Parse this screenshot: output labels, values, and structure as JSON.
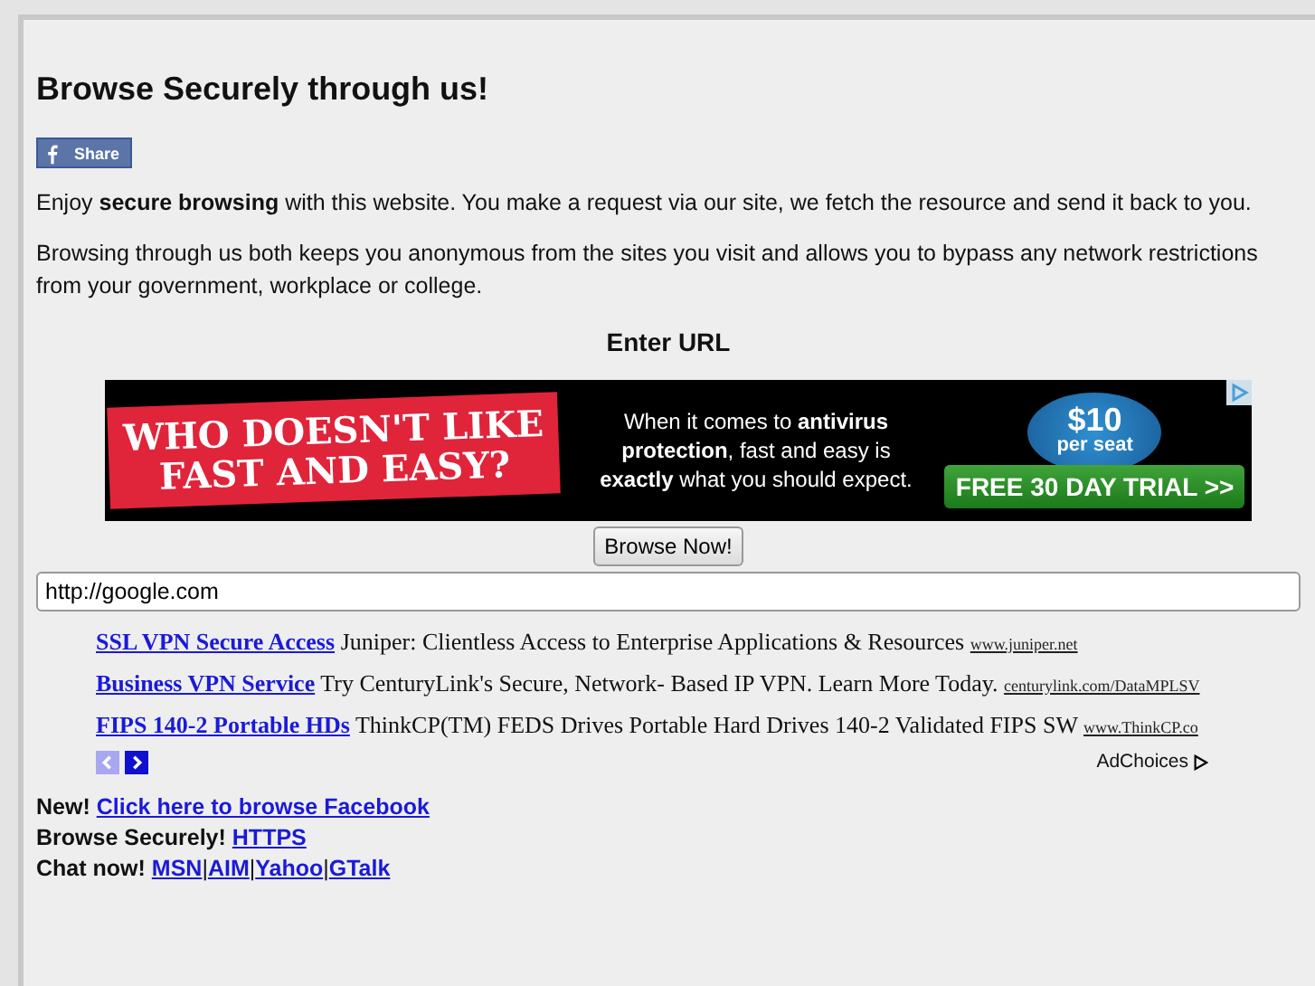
{
  "heading": "Browse Securely through us!",
  "share_button": "Share",
  "intro": "Enjoy **secure browsing** with this website. You make a request via our site, we fetch the resource and send it back to you.",
  "description": "Browsing through us both keeps you anonymous from the sites you visit and allows you to bypass any network restrictions from your government, workplace or college.",
  "url_label": "Enter URL",
  "banner": {
    "headline": "WHO DOESN'T LIKE FAST AND EASY?",
    "body": "When it comes to **antivirus protection**, fast and easy is **exactly** what you should expect.",
    "price": "$10",
    "price_unit": "per seat",
    "cta": "FREE 30 DAY TRIAL >>"
  },
  "browse_button": "Browse Now!",
  "url_field": {
    "value": "http://google.com"
  },
  "text_ads": [
    {
      "title": "SSL VPN Secure Access",
      "text": "Juniper: Clientless Access to Enterprise Applications & Resources",
      "url": "www.juniper.net"
    },
    {
      "title": "Business VPN Service",
      "text": "Try CenturyLink's Secure, Network- Based IP VPN. Learn More Today.",
      "url": "centurylink.com/DataMPLSV"
    },
    {
      "title": "FIPS 140-2 Portable HDs",
      "text": "ThinkCP(TM) FEDS Drives Portable Hard Drives 140-2 Validated FIPS SW",
      "url": "www.ThinkCP.co"
    }
  ],
  "ad_pager": [
    {
      "kind": "prev",
      "disabled": true
    },
    {
      "kind": "next",
      "disabled": false
    }
  ],
  "adchoices": "AdChoices",
  "promos": [
    {
      "lead": "New!",
      "links": [
        "Click here to browse Facebook"
      ]
    },
    {
      "lead": "Browse Securely!",
      "links": [
        "HTTPS"
      ]
    },
    {
      "lead": "Chat now!",
      "links": [
        "MSN",
        "AIM",
        "Yahoo",
        "GTalk"
      ]
    }
  ],
  "link_separator": "|"
}
